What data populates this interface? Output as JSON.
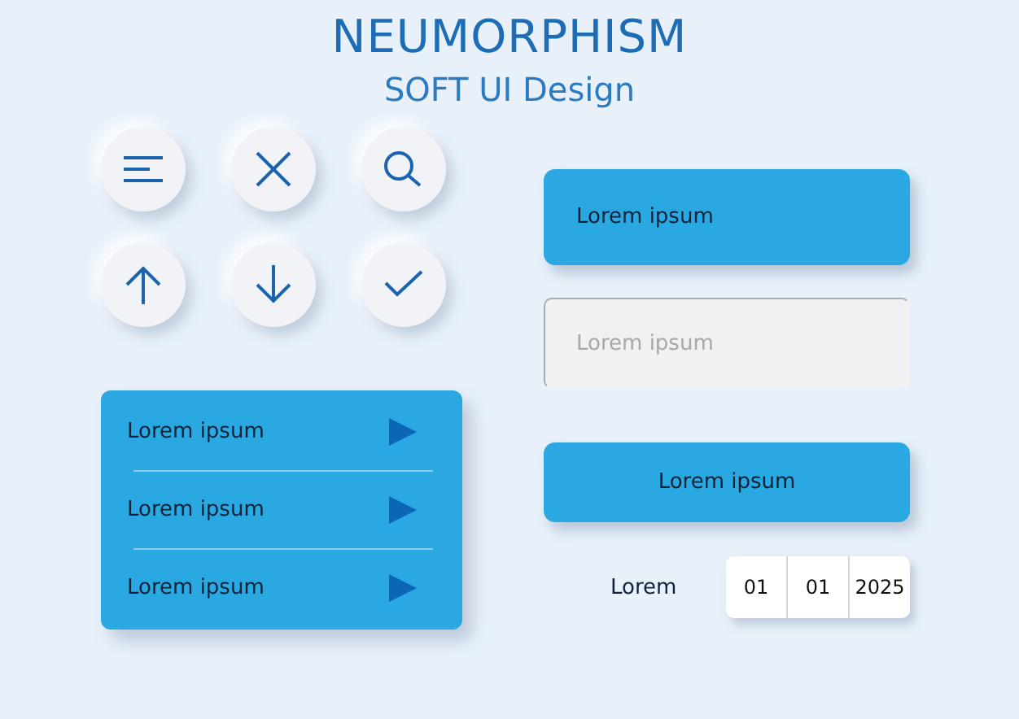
{
  "header": {
    "title": "NEUMORPHISM",
    "subtitle": "SOFT UI Design"
  },
  "icon_buttons": [
    {
      "kind": "menu"
    },
    {
      "kind": "close"
    },
    {
      "kind": "search"
    },
    {
      "kind": "up"
    },
    {
      "kind": "down"
    },
    {
      "kind": "check"
    }
  ],
  "list_menu": {
    "items": [
      {
        "label": "Lorem ipsum"
      },
      {
        "label": "Lorem ipsum"
      },
      {
        "label": "Lorem ipsum"
      }
    ]
  },
  "primary_button": {
    "label": "Lorem ipsum"
  },
  "text_field": {
    "placeholder": "Lorem ipsum"
  },
  "centered_button": {
    "label": "Lorem ipsum"
  },
  "date_picker": {
    "label": "Lorem",
    "day": "01",
    "month": "01",
    "year": "2025"
  }
}
